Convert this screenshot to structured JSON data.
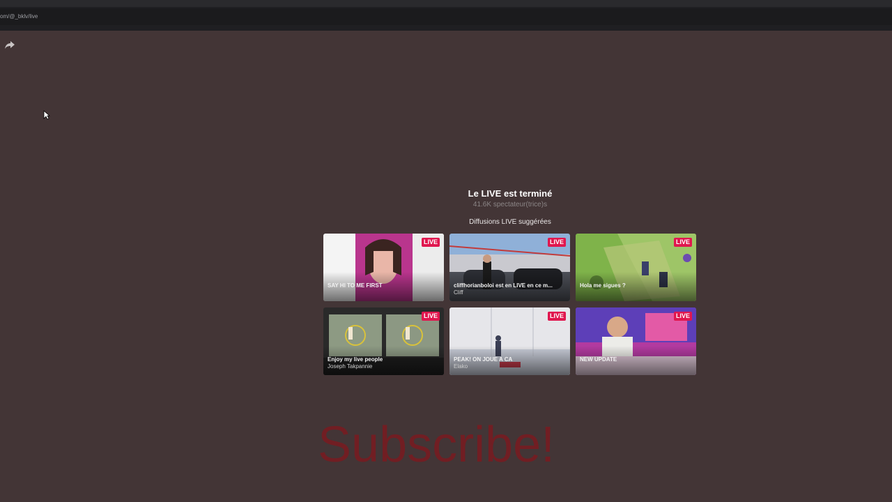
{
  "browser": {
    "url": "om/@_bklv/live"
  },
  "page": {
    "ended_title": "Le LIVE est terminé",
    "viewers": "41.6K spectateur(trice)s",
    "suggested_heading": "Diffusions LIVE suggérées"
  },
  "cards": [
    {
      "badge": "LIVE",
      "title": "SAY HI TO ME FIRST",
      "user": "",
      "thumb": "portrait-pink"
    },
    {
      "badge": "LIVE",
      "title": "cliffhorianboloi est en LIVE en ce m...",
      "user": "Cliff",
      "thumb": "car-lot"
    },
    {
      "badge": "LIVE",
      "title": "Hola me sigues ?",
      "user": "",
      "thumb": "game-green"
    },
    {
      "badge": "LIVE",
      "title": "Enjoy my live people",
      "user": "Joseph Takpannie",
      "thumb": "game-map"
    },
    {
      "badge": "LIVE",
      "title": "PEAK! ON JOUE A CA",
      "user": "Elako",
      "thumb": "game-white-room"
    },
    {
      "badge": "LIVE",
      "title": "NEW UPDATE",
      "user": "",
      "thumb": "streamer-room"
    }
  ],
  "overlay": {
    "subscribe": "Subscribe!"
  },
  "colors": {
    "background": "#433536",
    "live_badge": "#e0174f",
    "subscribe": "#7a1a20"
  }
}
